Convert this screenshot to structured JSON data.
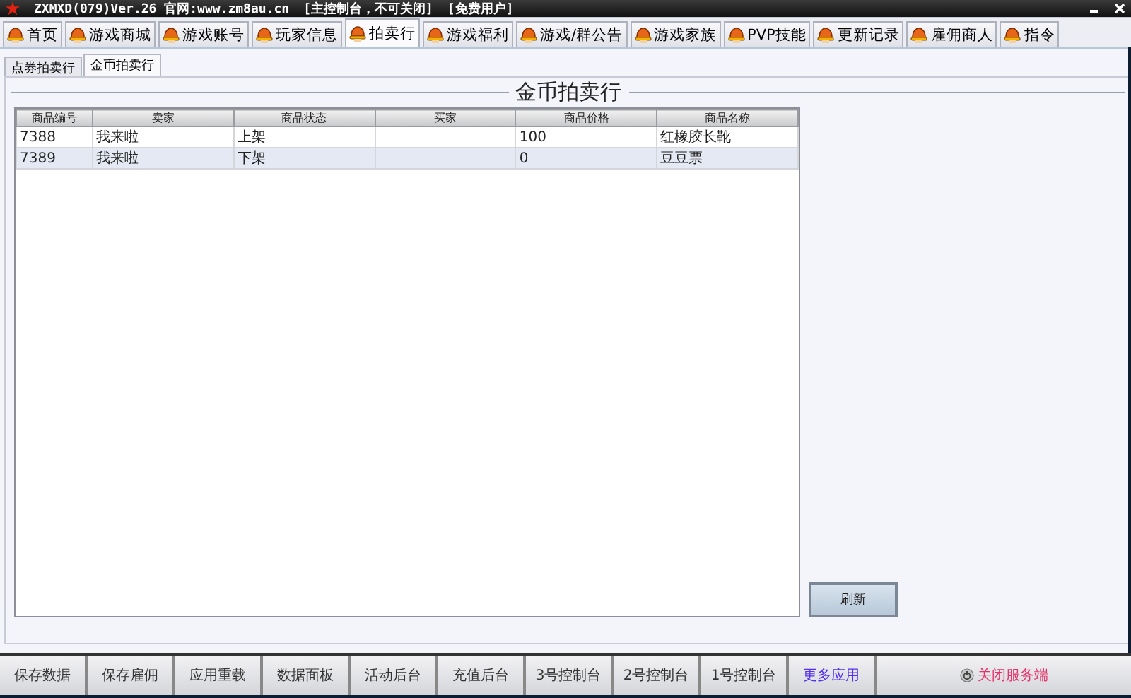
{
  "window": {
    "app": "ZXMXD(079)Ver.26 官网:www.zm8au.cn",
    "console": "[主控制台，不可关闭]",
    "license": "[免费用户]"
  },
  "tabs": [
    {
      "label": "首页",
      "selected": false
    },
    {
      "label": "游戏商城",
      "selected": false
    },
    {
      "label": "游戏账号",
      "selected": false
    },
    {
      "label": "玩家信息",
      "selected": false
    },
    {
      "label": "拍卖行",
      "selected": true
    },
    {
      "label": "游戏福利",
      "selected": false
    },
    {
      "label": "游戏/群公告",
      "selected": false
    },
    {
      "label": "游戏家族",
      "selected": false
    },
    {
      "label": "PVP技能",
      "selected": false
    },
    {
      "label": "更新记录",
      "selected": false
    },
    {
      "label": "雇佣商人",
      "selected": false
    },
    {
      "label": "指令",
      "selected": false
    }
  ],
  "subtabs": [
    {
      "label": "点券拍卖行",
      "selected": false
    },
    {
      "label": "金币拍卖行",
      "selected": true
    }
  ],
  "group_title": "金币拍卖行",
  "table": {
    "columns": [
      "商品编号",
      "卖家",
      "商品状态",
      "买家",
      "商品价格",
      "商品名称"
    ],
    "rows": [
      [
        "7388",
        "我来啦",
        "上架",
        "",
        "100",
        "红橡胶长靴"
      ],
      [
        "7389",
        "我来啦",
        "下架",
        "",
        "0",
        "豆豆票"
      ]
    ]
  },
  "refresh_button": "刷新",
  "bottom_buttons": [
    {
      "label": "保存数据",
      "kind": "normal"
    },
    {
      "label": "保存雇佣",
      "kind": "normal"
    },
    {
      "label": "应用重载",
      "kind": "normal"
    },
    {
      "label": "数据面板",
      "kind": "normal"
    },
    {
      "label": "活动后台",
      "kind": "normal"
    },
    {
      "label": "充值后台",
      "kind": "normal"
    },
    {
      "label": "3号控制台",
      "kind": "normal"
    },
    {
      "label": "2号控制台",
      "kind": "normal"
    },
    {
      "label": "1号控制台",
      "kind": "normal"
    },
    {
      "label": "更多应用",
      "kind": "link"
    },
    {
      "label": "关闭服务端",
      "kind": "danger"
    }
  ]
}
